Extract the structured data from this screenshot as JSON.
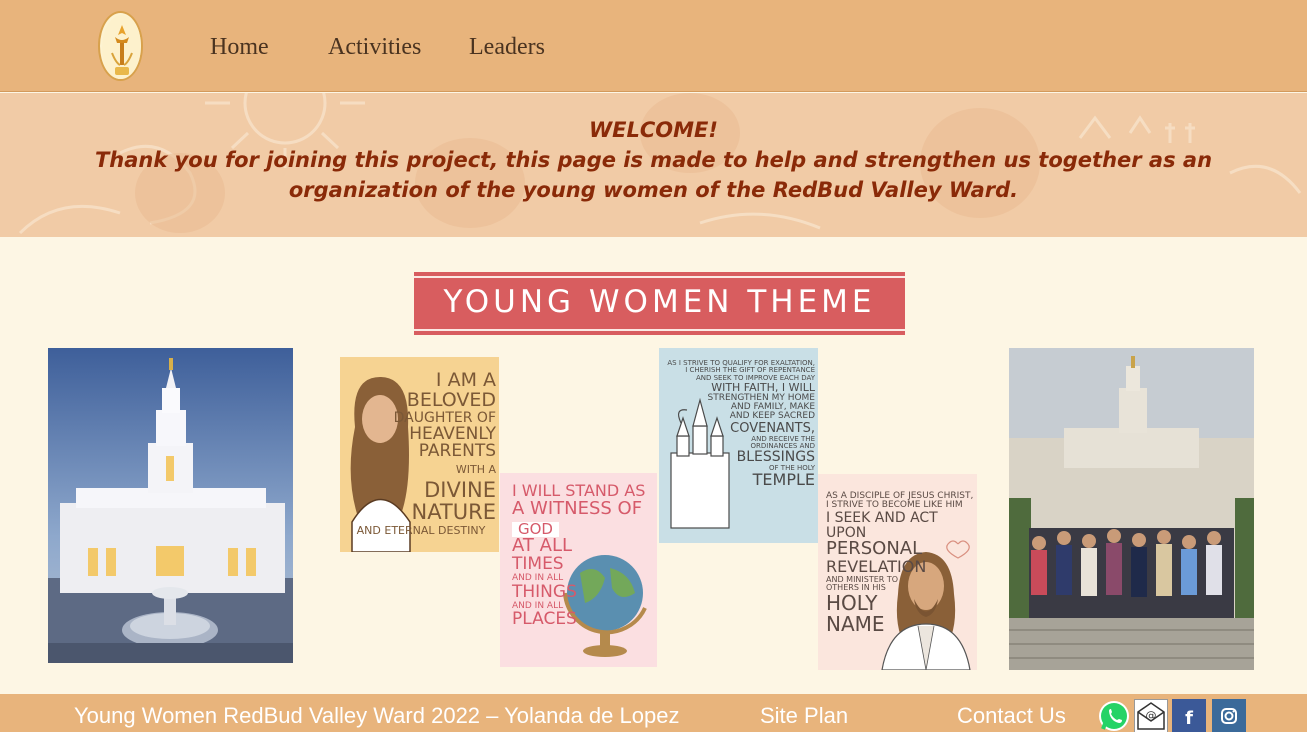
{
  "nav": {
    "logo_name": "torch-logo",
    "links": [
      "Home",
      "Activities",
      "Leaders"
    ]
  },
  "banner": {
    "title": "WELCOME!",
    "message": "Thank you for joining this project, this page is made to help and strengthen us together as an organization of the young women of the RedBud Valley Ward."
  },
  "theme": {
    "label": "YOUNG WOMEN THEME",
    "color": "#d85d5f"
  },
  "cards": [
    {
      "lines": [
        "I AM A BELOVED",
        "DAUGHTER OF",
        "HEAVENLY",
        "PARENTS",
        "WITH A",
        "DIVINE",
        "NATURE",
        "AND ETERNAL DESTINY"
      ],
      "bg": "#f6d392"
    },
    {
      "lines": [
        "I WILL STAND AS",
        "A WITNESS OF",
        "GOD",
        "AT ALL",
        "TIMES",
        "AND IN ALL",
        "THINGS",
        "AND IN ALL",
        "PLACES"
      ],
      "bg": "#fbdfe1"
    },
    {
      "lines": [
        "AS I STRIVE TO QUALIFY FOR EXALTATION,",
        "I CHERISH THE GIFT OF REPENTANCE",
        "AND SEEK TO IMPROVE EACH DAY",
        "WITH FAITH, I WILL",
        "STRENGTHEN MY HOME",
        "AND FAMILY, MAKE",
        "AND KEEP SACRED",
        "COVENANTS,",
        "AND RECEIVE THE",
        "ORDINANCES AND",
        "BLESSINGS",
        "OF THE HOLY",
        "TEMPLE"
      ],
      "bg": "#c9dfe6"
    },
    {
      "lines": [
        "AS A DISCIPLE OF JESUS CHRIST,",
        "I STRIVE TO BECOME LIKE HIM",
        "I SEEK AND ACT UPON",
        "PERSONAL",
        "REVELATION",
        "AND MINISTER TO",
        "OTHERS IN HIS",
        "HOLY",
        "NAME"
      ],
      "bg": "#fbe6dd"
    }
  ],
  "footer": {
    "credit": "Young Women RedBud Valley Ward  2022 – Yolanda de Lopez",
    "site_plan": "Site Plan",
    "contact": "Contact Us",
    "social_icons": [
      "whatsapp-icon",
      "email-icon",
      "facebook-icon",
      "instagram-icon"
    ]
  }
}
